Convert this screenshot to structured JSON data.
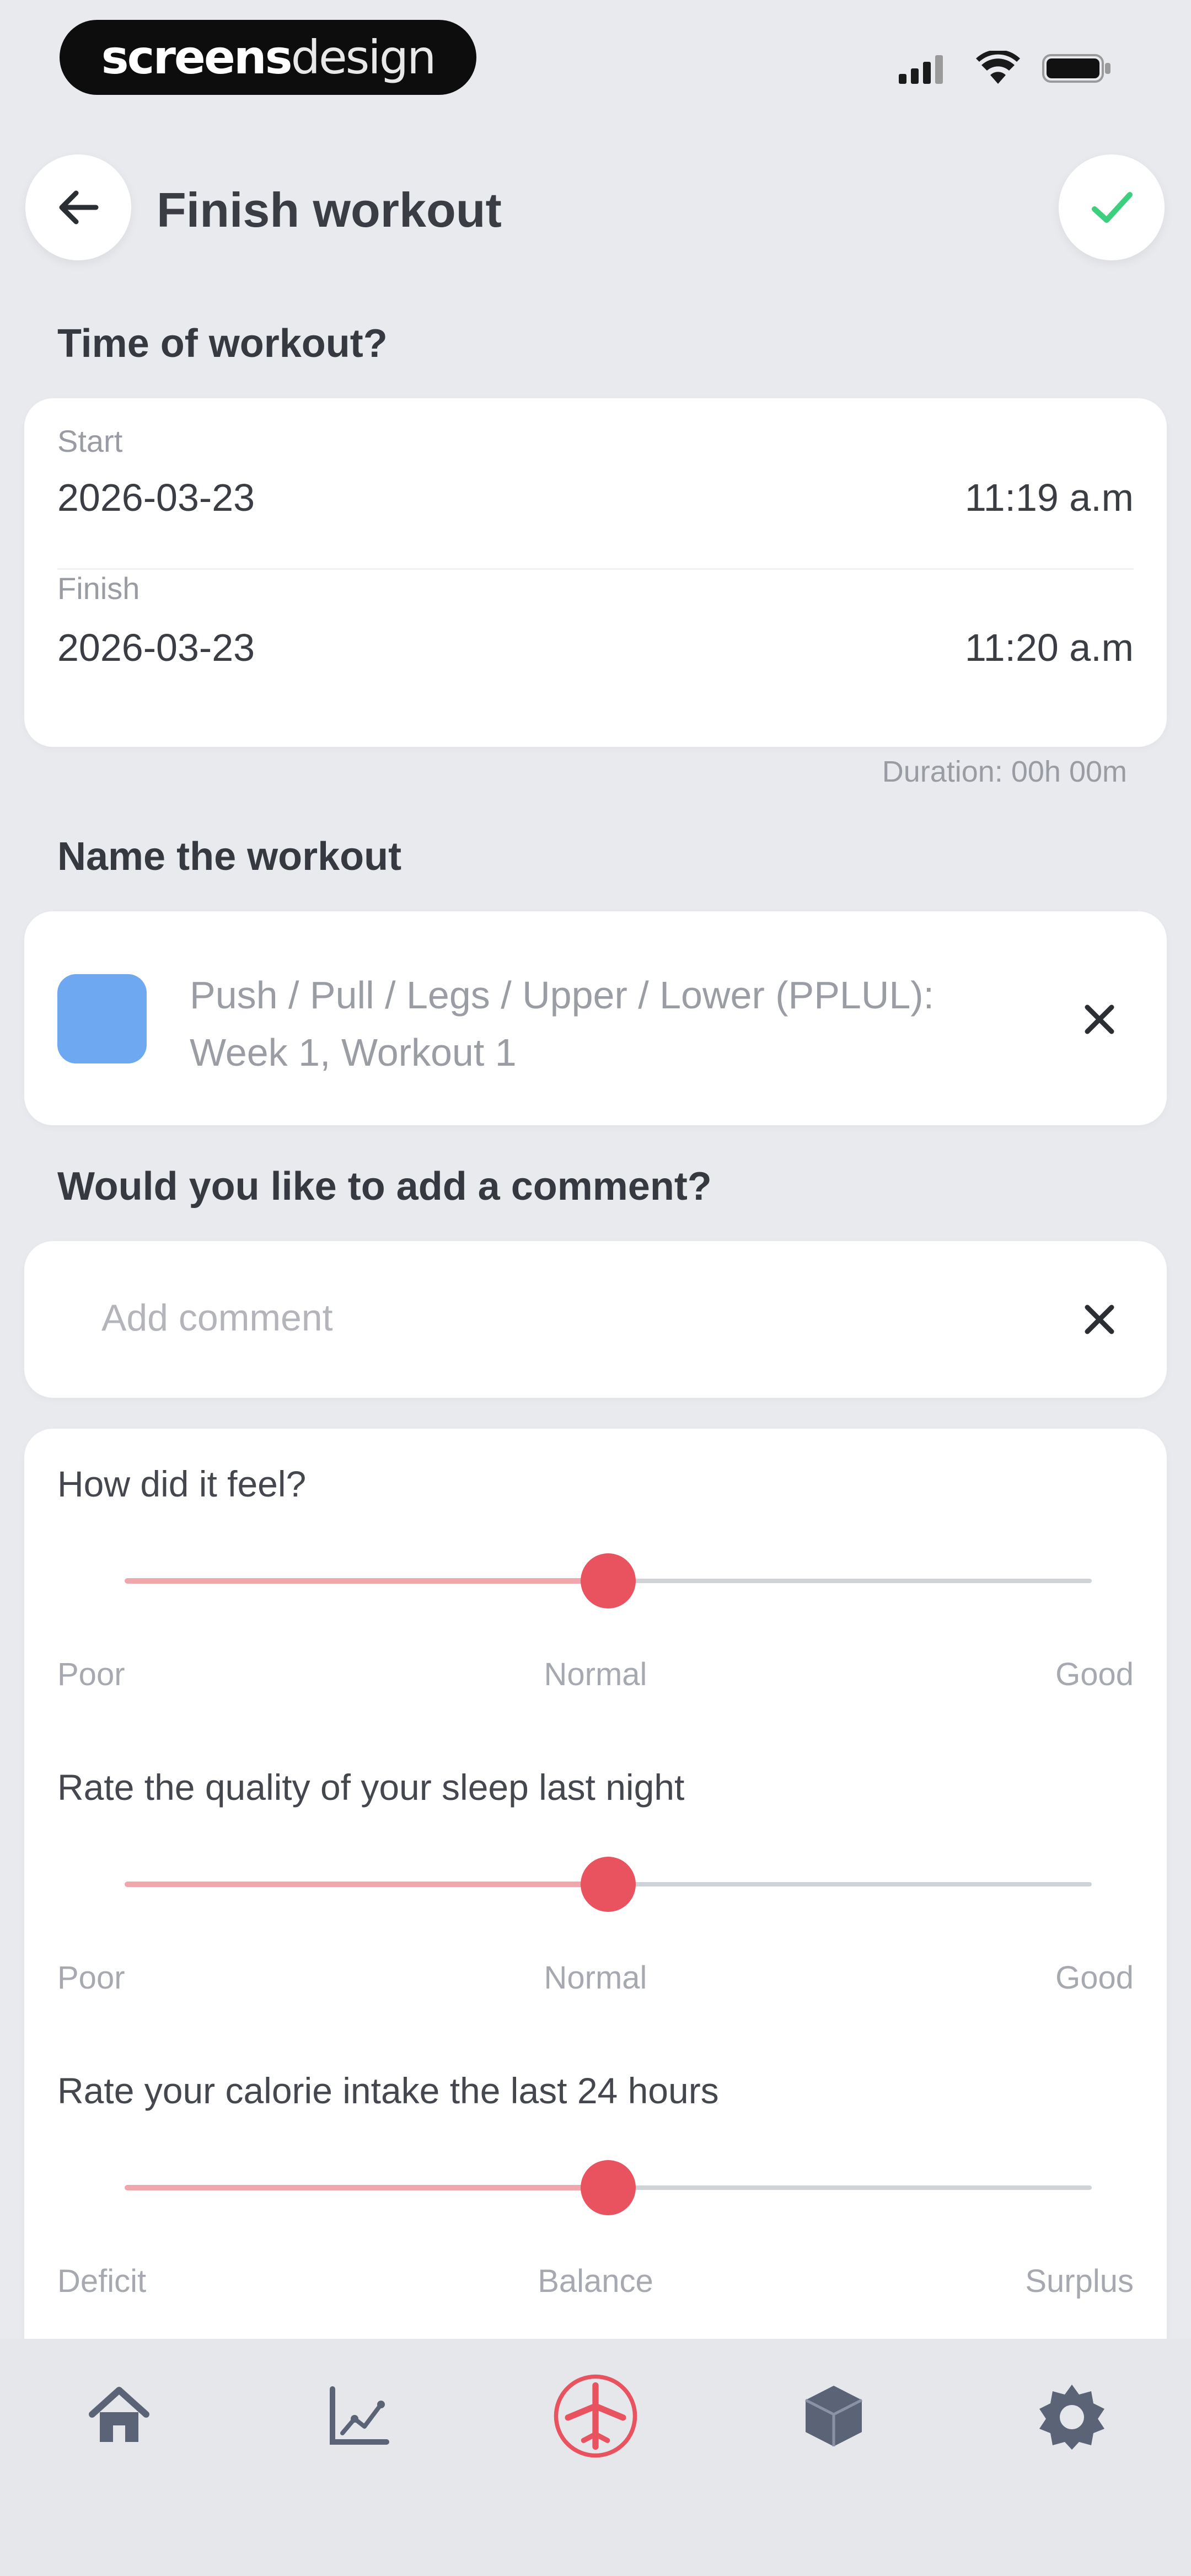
{
  "status_bar": {
    "brand_part1": "screens",
    "brand_part2": "design"
  },
  "header": {
    "title": "Finish workout",
    "back_icon": "arrow-left-icon",
    "confirm_icon": "checkmark-icon"
  },
  "time_section": {
    "heading": "Time of workout?",
    "start_label": "Start",
    "start_date": "2026-03-23",
    "start_time": "11:19 a.m",
    "finish_label": "Finish",
    "finish_date": "2026-03-23",
    "finish_time": "11:20 a.m",
    "duration": "Duration: 00h 00m"
  },
  "name_section": {
    "heading": "Name the workout",
    "color": "#6ea8f0",
    "name_line1": "Push / Pull / Legs / Upper / Lower (PPLUL):",
    "name_line2": "Week 1, Workout 1"
  },
  "comment_section": {
    "heading": "Would you like to add a comment?",
    "placeholder": "Add comment"
  },
  "ratings": [
    {
      "question": "How did it feel?",
      "low": "Poor",
      "mid": "Normal",
      "high": "Good",
      "value": 0.5
    },
    {
      "question": "Rate the quality of your sleep last night",
      "low": "Poor",
      "mid": "Normal",
      "high": "Good",
      "value": 0.5
    },
    {
      "question": "Rate your calorie intake the last 24 hours",
      "low": "Deficit",
      "mid": "Balance",
      "high": "Surplus",
      "value": 0.5
    }
  ],
  "bottom_nav": [
    {
      "icon": "home-icon",
      "active": false
    },
    {
      "icon": "chart-icon",
      "active": false
    },
    {
      "icon": "workout-icon",
      "active": true
    },
    {
      "icon": "cube-icon",
      "active": false
    },
    {
      "icon": "settings-icon",
      "active": false
    }
  ],
  "colors": {
    "accent": "#e8535f",
    "confirm": "#3ccf7e",
    "background": "#e9eaee"
  }
}
